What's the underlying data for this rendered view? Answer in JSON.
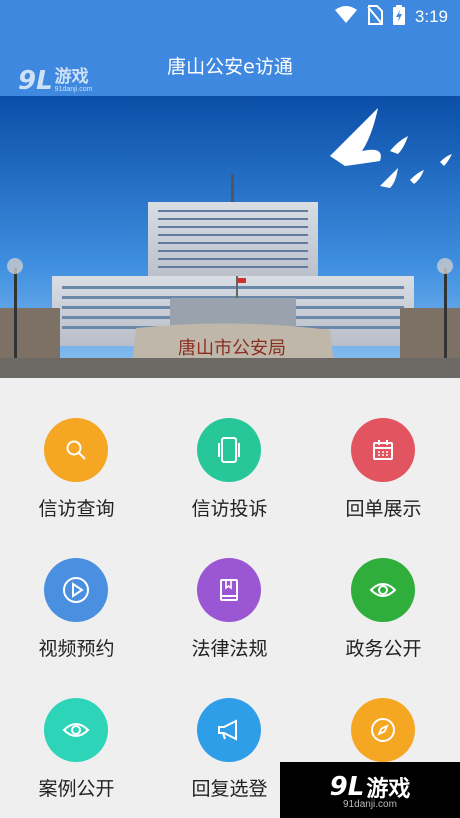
{
  "status_bar": {
    "time": "3:19",
    "icons": [
      "wifi-icon",
      "no-sim-icon",
      "battery-charging-icon"
    ]
  },
  "app_bar": {
    "title": "唐山公安e访通"
  },
  "watermark_top": {
    "num": "9L",
    "text": "游戏",
    "domain": "91danji.com"
  },
  "banner": {
    "sign_text": "唐山市公安局"
  },
  "menu": [
    {
      "label": "信访查询",
      "icon": "search-icon",
      "color": "#f5a623"
    },
    {
      "label": "信访投诉",
      "icon": "phone-device-icon",
      "color": "#27c79a"
    },
    {
      "label": "回单展示",
      "icon": "calendar-icon",
      "color": "#e2545f"
    },
    {
      "label": "视频预约",
      "icon": "play-icon",
      "color": "#4a8fe0"
    },
    {
      "label": "法律法规",
      "icon": "book-icon",
      "color": "#9b57d3"
    },
    {
      "label": "政务公开",
      "icon": "eye-icon",
      "color": "#2fae3c"
    },
    {
      "label": "案例公开",
      "icon": "eye-icon",
      "color": "#2ed4b8"
    },
    {
      "label": "回复选登",
      "icon": "megaphone-icon",
      "color": "#2f9ee8"
    },
    {
      "label": "",
      "icon": "compass-icon",
      "color": "#f5a623"
    }
  ],
  "watermark_bottom": {
    "num": "9L",
    "text": "游戏",
    "domain": "91danji.com"
  }
}
